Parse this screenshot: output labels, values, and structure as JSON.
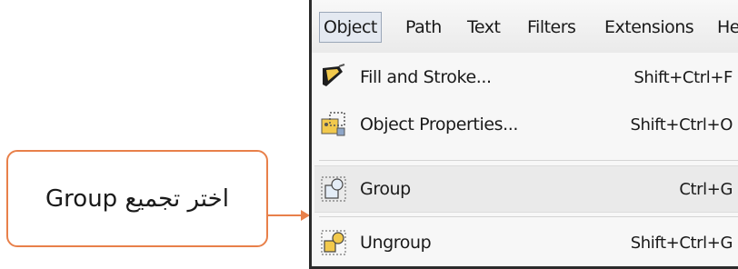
{
  "callout": {
    "text": "اختر تجميع Group"
  },
  "menubar": {
    "items": [
      {
        "label": "Object"
      },
      {
        "label": "Path"
      },
      {
        "label": "Text"
      },
      {
        "label": "Filters"
      },
      {
        "label": "Extensions"
      },
      {
        "label": "He"
      }
    ]
  },
  "menu": {
    "items": [
      {
        "label": "Fill and Stroke...",
        "shortcut": "Shift+Ctrl+F",
        "icon": "fill-stroke-icon"
      },
      {
        "label": "Object Properties...",
        "shortcut": "Shift+Ctrl+O",
        "icon": "object-properties-icon"
      },
      {
        "label": "Group",
        "shortcut": "Ctrl+G",
        "icon": "group-icon"
      },
      {
        "label": "Ungroup",
        "shortcut": "Shift+Ctrl+G",
        "icon": "ungroup-icon"
      }
    ]
  },
  "colors": {
    "callout_border": "#e8804a",
    "menu_bg": "#f7f7f7",
    "active_menu_bg": "#e4e9f1"
  }
}
